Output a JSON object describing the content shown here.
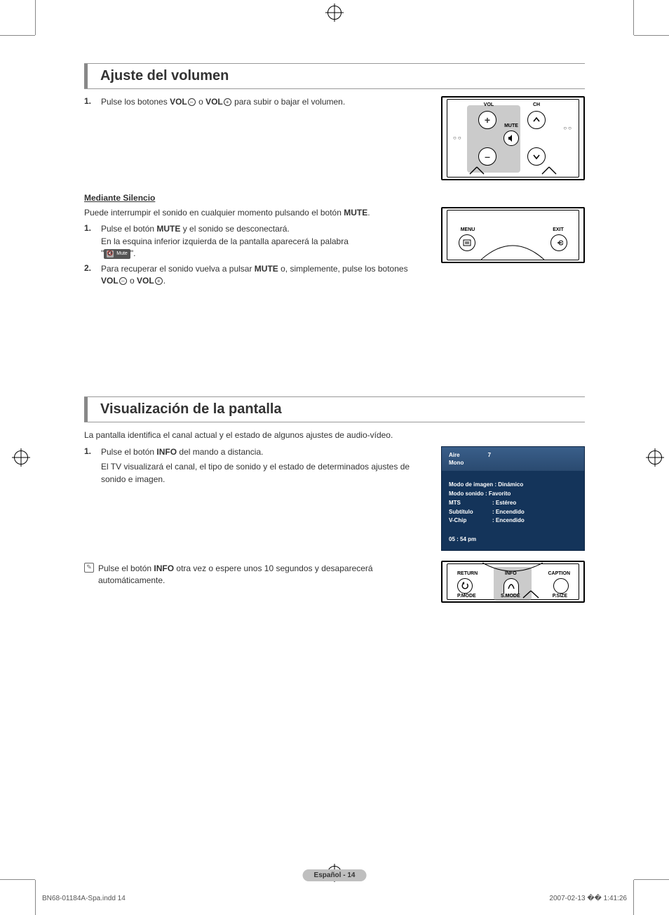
{
  "section1": {
    "title": "Ajuste del volumen",
    "step1_num": "1.",
    "step1_a": "Pulse los botones ",
    "vol": "VOL",
    "step1_b": " o ",
    "step1_c": " para subir o bajar el volumen.",
    "mediante_title": "Mediante Silencio",
    "mediante_intro_a": "Puede interrumpir el sonido en cualquier momento pulsando el botón ",
    "mute": "MUTE",
    "mediante_intro_b": ".",
    "m_step1_num": "1.",
    "m_step1_a": "Pulse el botón ",
    "m_step1_b": " y el sonido se desconectará.",
    "m_step1_line2": "En la esquina inferior izquierda de la pantalla aparecerá la palabra",
    "m_step1_chip": "Mute",
    "m_step1_end": ".",
    "m_step2_num": "2.",
    "m_step2_a": "Para recuperar el sonido vuelva a pulsar ",
    "m_step2_b": " o, simplemente, pulse los botones ",
    "m_step2_c": " o ",
    "m_step2_d": "."
  },
  "fig1": {
    "vol_label": "VOL",
    "ch_label": "CH",
    "mute_label": "MUTE",
    "plus": "+",
    "minus": "–"
  },
  "fig2": {
    "menu": "MENU",
    "exit": "EXIT"
  },
  "section2": {
    "title": "Visualización de la pantalla",
    "intro": "La pantalla identifica el canal actual y el estado de algunos ajustes de audio-vídeo.",
    "step1_num": "1.",
    "step1_a": "Pulse el botón ",
    "info": "INFO",
    "step1_b": " del mando a distancia.",
    "step1_line2": "El TV visualizará el canal, el tipo de sonido y el estado de determinados ajustes de sonido e imagen.",
    "note_a": "Pulse el botón ",
    "note_b": " otra vez o espere unos 10 segundos y desaparecerá automáticamente."
  },
  "osd": {
    "aire": "Aire",
    "num": "7",
    "mono": "Mono",
    "modo_imagen": "Modo de imagen : Dinámico",
    "modo_sonido": "Modo sonido : Favorito",
    "mts_k": "MTS",
    "mts_v": ": Estéreo",
    "sub_k": "Subtítulo",
    "sub_v": ": Encendido",
    "vchip_k": "V-Chip",
    "vchip_v": ": Encendido",
    "time": "05 : 54 pm"
  },
  "fig3": {
    "return": "RETURN",
    "info": "INFO",
    "caption": "CAPTION",
    "pmode": "P.MODE",
    "smode": "S.MODE",
    "psize": "P.SIZE"
  },
  "pagetag_a": "Español - ",
  "pagetag_b": "14",
  "footer_left": "BN68-01184A-Spa.indd   14",
  "footer_right": "2007-02-13   �� 1:41:26"
}
